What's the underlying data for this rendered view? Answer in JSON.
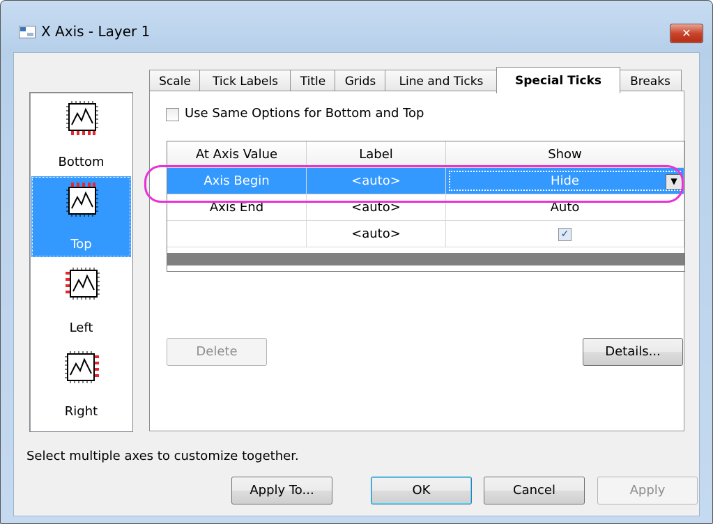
{
  "window": {
    "title": "X Axis - Layer 1",
    "close_label": "✕"
  },
  "axes": [
    {
      "label": "Bottom",
      "icon": "axis-bottom-icon"
    },
    {
      "label": "Top",
      "icon": "axis-top-icon",
      "selected": true
    },
    {
      "label": "Left",
      "icon": "axis-left-icon"
    },
    {
      "label": "Right",
      "icon": "axis-right-icon"
    }
  ],
  "tabs": [
    {
      "label": "Scale"
    },
    {
      "label": "Tick Labels"
    },
    {
      "label": "Title"
    },
    {
      "label": "Grids"
    },
    {
      "label": "Line and Ticks"
    },
    {
      "label": "Special Ticks",
      "active": true
    },
    {
      "label": "Breaks"
    }
  ],
  "special_ticks": {
    "same_options_label": "Use Same Options for Bottom and Top",
    "same_options_checked": false,
    "columns": [
      "At Axis Value",
      "Label",
      "Show"
    ],
    "rows": [
      {
        "at": "Axis Begin",
        "label": "<auto>",
        "show": "Hide",
        "selected": true
      },
      {
        "at": "Axis End",
        "label": "<auto>",
        "show": "Auto"
      },
      {
        "at": "",
        "label": "<auto>",
        "show": "✓"
      }
    ],
    "delete_label": "Delete",
    "details_label": "Details..."
  },
  "hint": "Select multiple axes to customize together.",
  "buttons": {
    "apply_to": "Apply To...",
    "ok": "OK",
    "cancel": "Cancel",
    "apply": "Apply"
  },
  "colors": {
    "selection": "#3399ff",
    "highlight": "#e832d6",
    "tick_marker": "#e8262b"
  }
}
